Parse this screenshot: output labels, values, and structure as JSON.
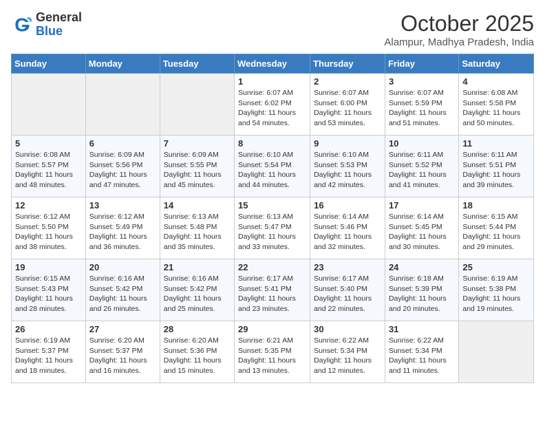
{
  "header": {
    "logo_general": "General",
    "logo_blue": "Blue",
    "month_title": "October 2025",
    "location": "Alampur, Madhya Pradesh, India"
  },
  "weekdays": [
    "Sunday",
    "Monday",
    "Tuesday",
    "Wednesday",
    "Thursday",
    "Friday",
    "Saturday"
  ],
  "weeks": [
    [
      {
        "day": "",
        "info": ""
      },
      {
        "day": "",
        "info": ""
      },
      {
        "day": "",
        "info": ""
      },
      {
        "day": "1",
        "info": "Sunrise: 6:07 AM\nSunset: 6:02 PM\nDaylight: 11 hours\nand 54 minutes."
      },
      {
        "day": "2",
        "info": "Sunrise: 6:07 AM\nSunset: 6:00 PM\nDaylight: 11 hours\nand 53 minutes."
      },
      {
        "day": "3",
        "info": "Sunrise: 6:07 AM\nSunset: 5:59 PM\nDaylight: 11 hours\nand 51 minutes."
      },
      {
        "day": "4",
        "info": "Sunrise: 6:08 AM\nSunset: 5:58 PM\nDaylight: 11 hours\nand 50 minutes."
      }
    ],
    [
      {
        "day": "5",
        "info": "Sunrise: 6:08 AM\nSunset: 5:57 PM\nDaylight: 11 hours\nand 48 minutes."
      },
      {
        "day": "6",
        "info": "Sunrise: 6:09 AM\nSunset: 5:56 PM\nDaylight: 11 hours\nand 47 minutes."
      },
      {
        "day": "7",
        "info": "Sunrise: 6:09 AM\nSunset: 5:55 PM\nDaylight: 11 hours\nand 45 minutes."
      },
      {
        "day": "8",
        "info": "Sunrise: 6:10 AM\nSunset: 5:54 PM\nDaylight: 11 hours\nand 44 minutes."
      },
      {
        "day": "9",
        "info": "Sunrise: 6:10 AM\nSunset: 5:53 PM\nDaylight: 11 hours\nand 42 minutes."
      },
      {
        "day": "10",
        "info": "Sunrise: 6:11 AM\nSunset: 5:52 PM\nDaylight: 11 hours\nand 41 minutes."
      },
      {
        "day": "11",
        "info": "Sunrise: 6:11 AM\nSunset: 5:51 PM\nDaylight: 11 hours\nand 39 minutes."
      }
    ],
    [
      {
        "day": "12",
        "info": "Sunrise: 6:12 AM\nSunset: 5:50 PM\nDaylight: 11 hours\nand 38 minutes."
      },
      {
        "day": "13",
        "info": "Sunrise: 6:12 AM\nSunset: 5:49 PM\nDaylight: 11 hours\nand 36 minutes."
      },
      {
        "day": "14",
        "info": "Sunrise: 6:13 AM\nSunset: 5:48 PM\nDaylight: 11 hours\nand 35 minutes."
      },
      {
        "day": "15",
        "info": "Sunrise: 6:13 AM\nSunset: 5:47 PM\nDaylight: 11 hours\nand 33 minutes."
      },
      {
        "day": "16",
        "info": "Sunrise: 6:14 AM\nSunset: 5:46 PM\nDaylight: 11 hours\nand 32 minutes."
      },
      {
        "day": "17",
        "info": "Sunrise: 6:14 AM\nSunset: 5:45 PM\nDaylight: 11 hours\nand 30 minutes."
      },
      {
        "day": "18",
        "info": "Sunrise: 6:15 AM\nSunset: 5:44 PM\nDaylight: 11 hours\nand 29 minutes."
      }
    ],
    [
      {
        "day": "19",
        "info": "Sunrise: 6:15 AM\nSunset: 5:43 PM\nDaylight: 11 hours\nand 28 minutes."
      },
      {
        "day": "20",
        "info": "Sunrise: 6:16 AM\nSunset: 5:42 PM\nDaylight: 11 hours\nand 26 minutes."
      },
      {
        "day": "21",
        "info": "Sunrise: 6:16 AM\nSunset: 5:42 PM\nDaylight: 11 hours\nand 25 minutes."
      },
      {
        "day": "22",
        "info": "Sunrise: 6:17 AM\nSunset: 5:41 PM\nDaylight: 11 hours\nand 23 minutes."
      },
      {
        "day": "23",
        "info": "Sunrise: 6:17 AM\nSunset: 5:40 PM\nDaylight: 11 hours\nand 22 minutes."
      },
      {
        "day": "24",
        "info": "Sunrise: 6:18 AM\nSunset: 5:39 PM\nDaylight: 11 hours\nand 20 minutes."
      },
      {
        "day": "25",
        "info": "Sunrise: 6:19 AM\nSunset: 5:38 PM\nDaylight: 11 hours\nand 19 minutes."
      }
    ],
    [
      {
        "day": "26",
        "info": "Sunrise: 6:19 AM\nSunset: 5:37 PM\nDaylight: 11 hours\nand 18 minutes."
      },
      {
        "day": "27",
        "info": "Sunrise: 6:20 AM\nSunset: 5:37 PM\nDaylight: 11 hours\nand 16 minutes."
      },
      {
        "day": "28",
        "info": "Sunrise: 6:20 AM\nSunset: 5:36 PM\nDaylight: 11 hours\nand 15 minutes."
      },
      {
        "day": "29",
        "info": "Sunrise: 6:21 AM\nSunset: 5:35 PM\nDaylight: 11 hours\nand 13 minutes."
      },
      {
        "day": "30",
        "info": "Sunrise: 6:22 AM\nSunset: 5:34 PM\nDaylight: 11 hours\nand 12 minutes."
      },
      {
        "day": "31",
        "info": "Sunrise: 6:22 AM\nSunset: 5:34 PM\nDaylight: 11 hours\nand 11 minutes."
      },
      {
        "day": "",
        "info": ""
      }
    ]
  ]
}
